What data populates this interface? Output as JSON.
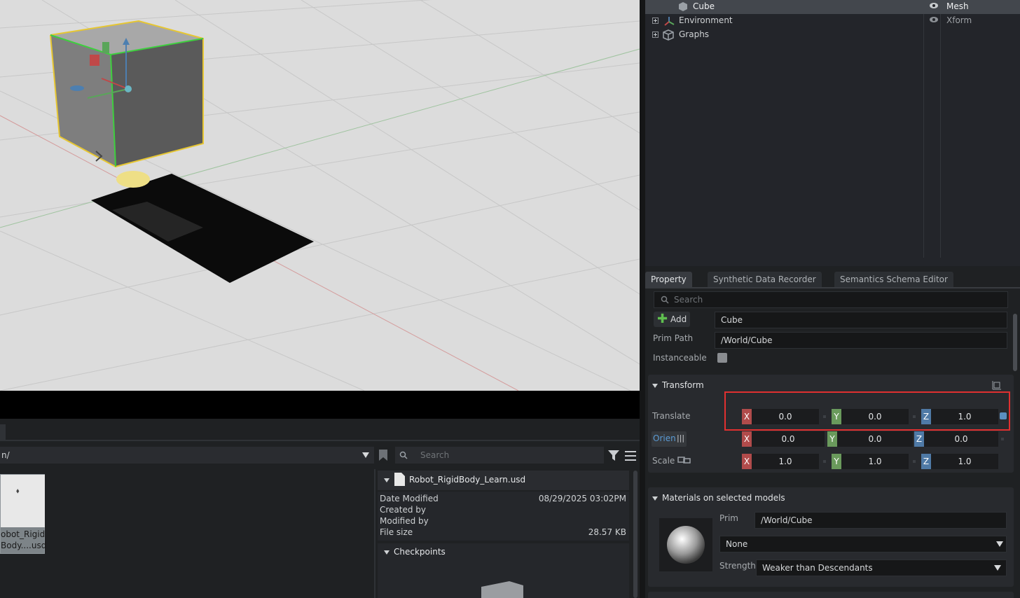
{
  "stage": {
    "rows": [
      {
        "name": "Cube",
        "type": "Mesh",
        "selected": true
      },
      {
        "name": "Environment",
        "type": "Xform"
      },
      {
        "name": "Graphs",
        "type": ""
      }
    ]
  },
  "property": {
    "tabs": [
      "Property",
      "Synthetic Data Recorder",
      "Semantics Schema Editor"
    ],
    "search_placeholder": "Search",
    "add_label": "Add",
    "prim_name": "Cube",
    "prim_path_label": "Prim Path",
    "prim_path": "/World/Cube",
    "instanceable_label": "Instanceable",
    "transform": {
      "title": "Transform",
      "translate_label": "Translate",
      "orient_label": "Orien",
      "scale_label": "Scale",
      "translate": {
        "x": "0.0",
        "y": "0.0",
        "z": "1.0"
      },
      "orient": {
        "x": "0.0",
        "y": "0.0",
        "z": "0.0"
      },
      "scale": {
        "x": "1.0",
        "y": "1.0",
        "z": "1.0"
      }
    },
    "materials": {
      "title": "Materials on selected models",
      "prim_label": "Prim",
      "prim_value": "/World/Cube",
      "material_value": "None",
      "strength_label": "Strength",
      "strength_value": "Weaker than Descendants"
    }
  },
  "content": {
    "path": "n/",
    "search_placeholder": "Search",
    "thumbnail_label_1": "obot_Rigid",
    "thumbnail_label_2": "Body....usd",
    "file_name": "Robot_RigidBody_Learn.usd",
    "date_modified_label": "Date Modified",
    "date_modified": "08/29/2025 03:02PM",
    "created_by_label": "Created by",
    "modified_by_label": "Modified by",
    "file_size_label": "File size",
    "file_size": "28.57 KB",
    "checkpoints_label": "Checkpoints"
  },
  "colors": {
    "highlight": "#e03030",
    "accent": "#4f7aa6"
  }
}
